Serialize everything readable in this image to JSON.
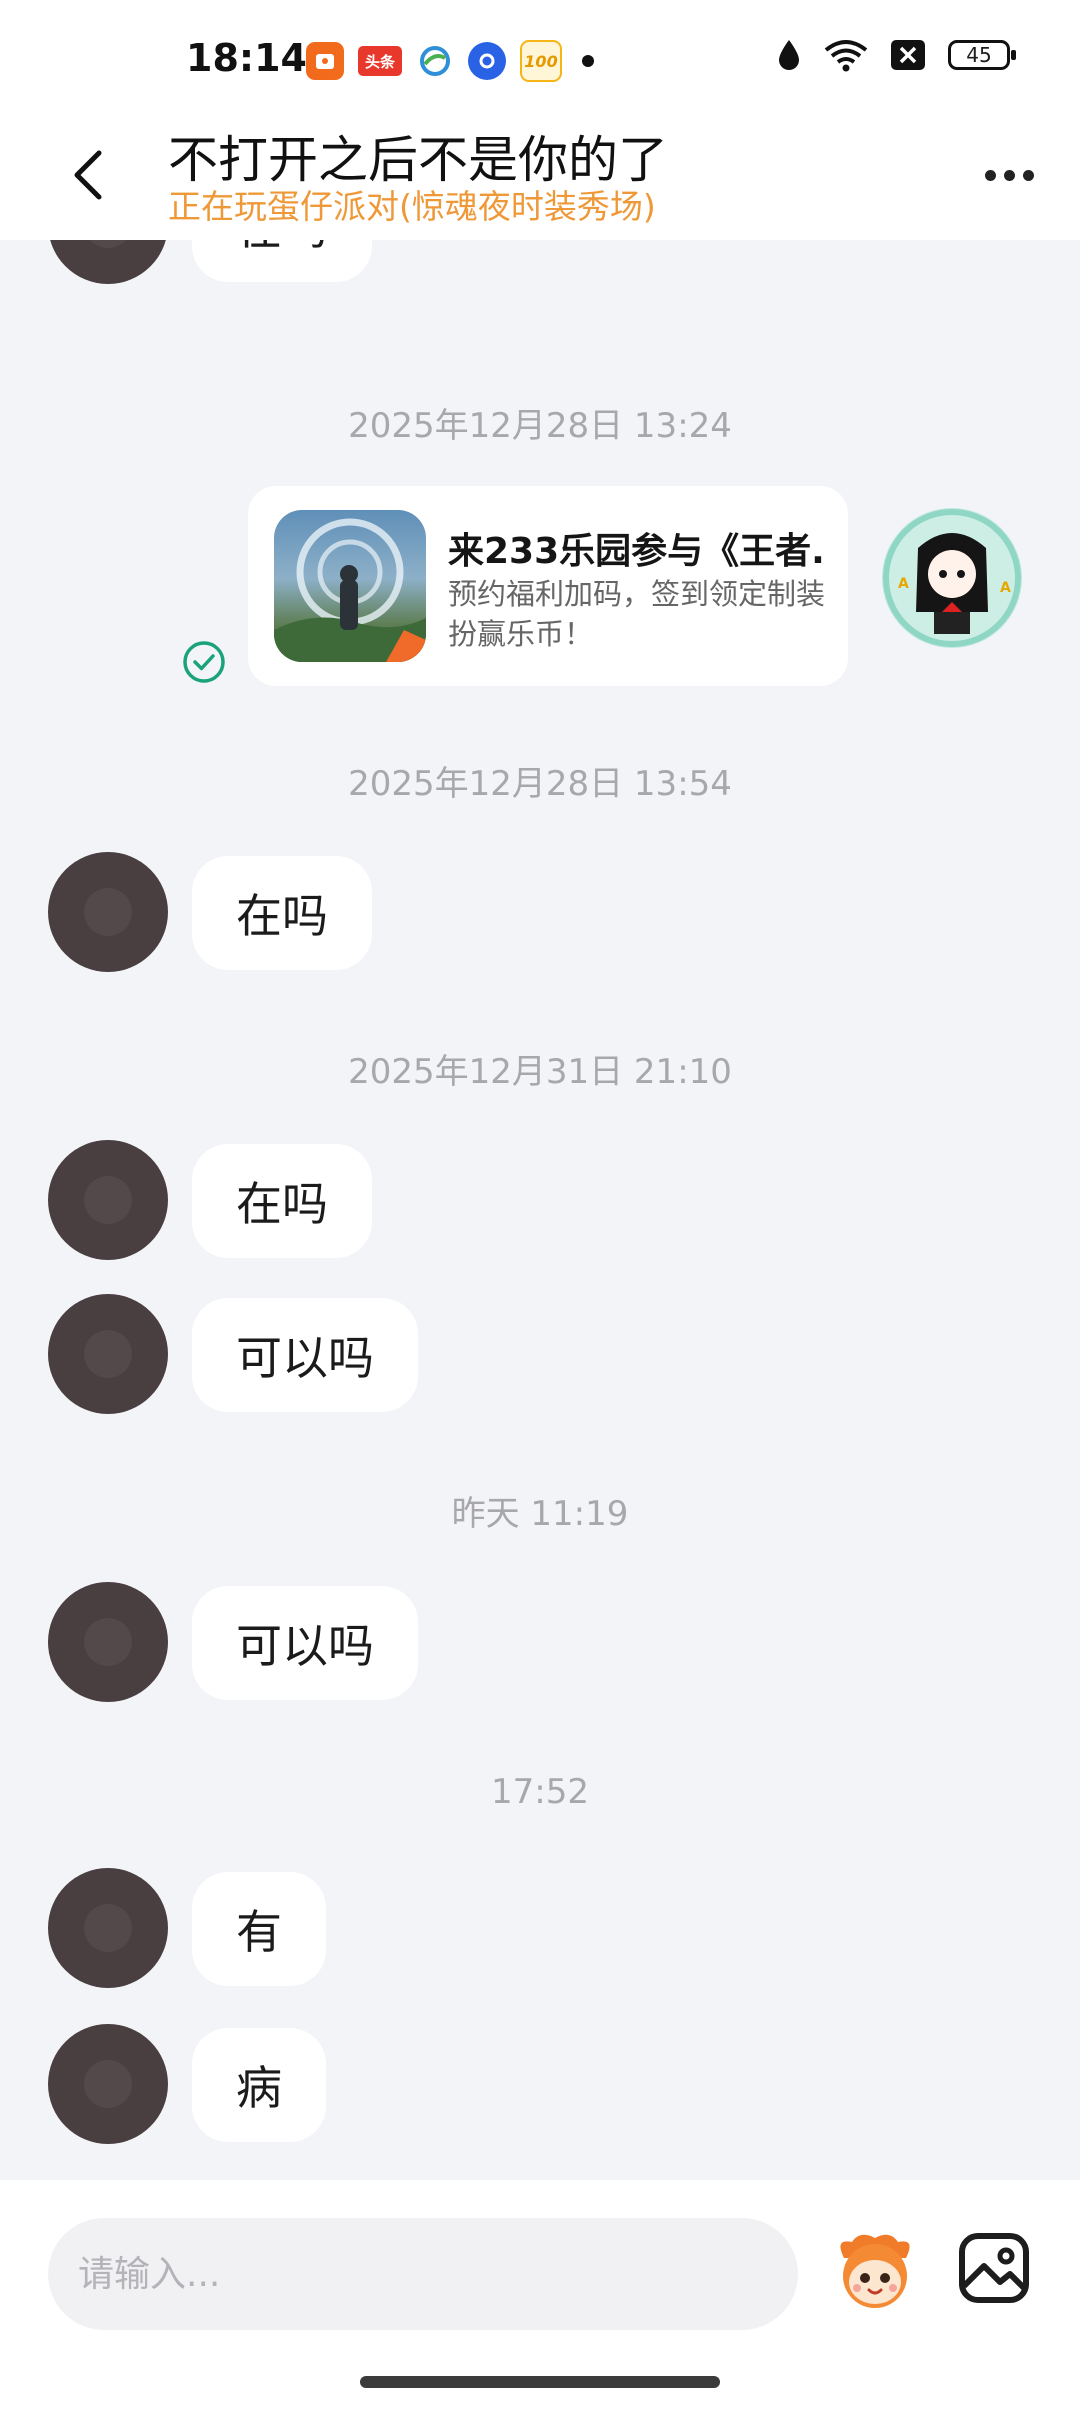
{
  "status_bar": {
    "time": "18:14",
    "app_icons": [
      {
        "name": "app-icon-orange",
        "text": "",
        "color": "#f26b1d"
      },
      {
        "name": "toutiao-icon",
        "text": "头条",
        "color": "#e8382b"
      },
      {
        "name": "mobile-icon",
        "text": "",
        "color": "#2f8fd8"
      },
      {
        "name": "circle-app-icon",
        "text": "",
        "color": "#2a62e5"
      },
      {
        "name": "hundred-app-icon",
        "text": "100",
        "color": "#f5b516"
      }
    ],
    "battery": "45"
  },
  "header": {
    "title": "不打开之后不是你的了",
    "subtitle": "正在玩蛋仔派对(惊魂夜时装秀场)"
  },
  "messages": {
    "m0": "在吗",
    "ts1": "2025年12月28日 13:24",
    "card": {
      "title": "来233乐园参与《王者...",
      "desc": "预约福利加码，签到领定制装扮赢乐币！"
    },
    "ts2": "2025年12月28日 13:54",
    "m1": "在吗",
    "ts3": "2025年12月31日 21:10",
    "m2": "在吗",
    "m3": "可以吗",
    "ts4": "昨天 11:19",
    "m4": "可以吗",
    "ts5": "17:52",
    "m5": "有",
    "m6": "病"
  },
  "input": {
    "placeholder": "请输入..."
  },
  "colors": {
    "accent_orange": "#ef9837",
    "sent_check_green": "#1aa37a",
    "chat_background": "#f3f4f8"
  }
}
